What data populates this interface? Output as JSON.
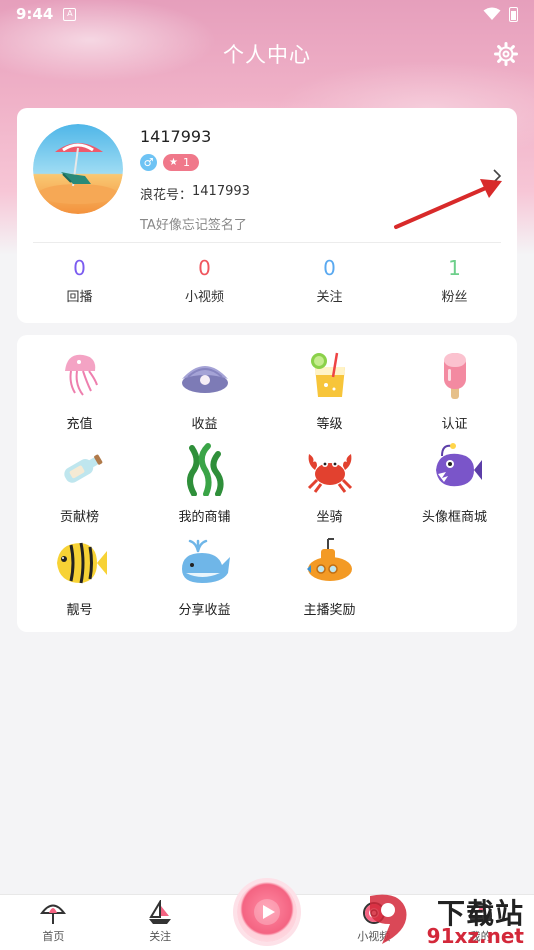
{
  "status_bar": {
    "time": "9:44",
    "notification_glyph": "A"
  },
  "header": {
    "title": "个人中心",
    "settings_icon": "gear-icon"
  },
  "profile": {
    "user_id": "1417993",
    "gender_symbol": "♂",
    "level": "1",
    "wave_id_label": "浪花号：",
    "wave_id_value": "1417993",
    "signature": "TA好像忘记签名了",
    "chevron_glyph": "›"
  },
  "stats": [
    {
      "value": "0",
      "label": "回播",
      "color": "#7b5cf0"
    },
    {
      "value": "0",
      "label": "小视频",
      "color": "#f0565e"
    },
    {
      "value": "0",
      "label": "关注",
      "color": "#5aa9f0"
    },
    {
      "value": "1",
      "label": "粉丝",
      "color": "#6dcf8a"
    }
  ],
  "features": [
    {
      "label": "充值",
      "icon": "jellyfish-icon"
    },
    {
      "label": "收益",
      "icon": "shell-icon"
    },
    {
      "label": "等级",
      "icon": "drink-icon"
    },
    {
      "label": "认证",
      "icon": "popsicle-icon"
    },
    {
      "label": "贡献榜",
      "icon": "bottle-icon"
    },
    {
      "label": "我的商铺",
      "icon": "seaweed-icon"
    },
    {
      "label": "坐骑",
      "icon": "crab-icon"
    },
    {
      "label": "头像框商城",
      "icon": "anglerfish-icon"
    },
    {
      "label": "靓号",
      "icon": "fish-icon"
    },
    {
      "label": "分享收益",
      "icon": "whale-icon"
    },
    {
      "label": "主播奖励",
      "icon": "submarine-icon"
    }
  ],
  "nav": [
    {
      "label": "首页",
      "icon": "umbrella-icon"
    },
    {
      "label": "关注",
      "icon": "sailboat-icon"
    },
    {
      "label": "",
      "icon": "play-icon"
    },
    {
      "label": "小视频",
      "icon": "lifebuoy-icon"
    },
    {
      "label": "我的",
      "icon": "captain-hat-icon"
    }
  ],
  "watermark": {
    "main": "下载站",
    "sub": "91xz.net"
  },
  "colors": {
    "accent": "#f46482",
    "card": "#ffffff",
    "background": "#f4f4f6"
  }
}
